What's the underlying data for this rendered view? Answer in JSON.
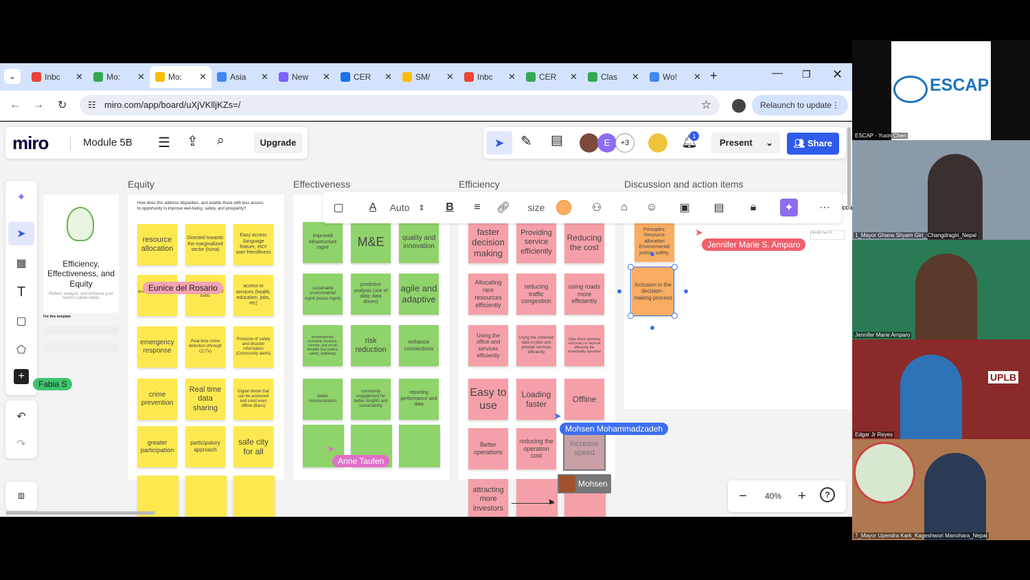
{
  "browser": {
    "tabs": [
      {
        "label": "Inbc",
        "color": "#ea4335"
      },
      {
        "label": "Mo:",
        "color": "#34a853"
      },
      {
        "label": "Mo:",
        "color": "#fbbc04"
      },
      {
        "label": "Asia",
        "color": "#4285f4"
      },
      {
        "label": "New",
        "color": "#7b61ff"
      },
      {
        "label": "CER",
        "color": "#1a73e8"
      },
      {
        "label": "SM/",
        "color": "#fbbc04"
      },
      {
        "label": "Inbc",
        "color": "#ea4335"
      },
      {
        "label": "CER",
        "color": "#34a853"
      },
      {
        "label": "Clas",
        "color": "#34a853"
      },
      {
        "label": "Wo!",
        "color": "#4285f4"
      }
    ],
    "url": "miro.com/app/board/uXjVKlljKZs=/",
    "relaunch": "Relaunch to update"
  },
  "miro": {
    "logo": "miro",
    "board_name": "Module 5B",
    "upgrade": "Upgrade",
    "present": "Present",
    "share": "Share",
    "avatar_extra": "+3",
    "avatar_e": "E",
    "notif_count": "1",
    "zoom": "40%",
    "template_title": "Efficiency, Effectiveness, and Equity",
    "template_sub": "Reflect, analyze, and enhance your team's collaboration",
    "template_hint": "For this template",
    "toolbar": {
      "font": "Auto",
      "size": "size"
    },
    "sections": [
      "Equity",
      "Effectiveness",
      "Efficiency",
      "Discussion and action items"
    ],
    "equity_prompt": "How does this address disparities, and enable those with less access to opportunity to improve well-being, safety, and prosperity?",
    "equity": [
      "resource allocation",
      "Directed towards the marginalized sector (Isma)",
      "Easy access (language feature, etcV user friendliness",
      "",
      "",
      "access to services (health, education, jobs, etc)",
      "emergency response",
      "Real-time crime detection (through CCTV)",
      "Provision of safety and disaster information (Community alerts)",
      "crime prevention",
      "Real time data sharing",
      "Digital divide that can be accessed and used even offline (Baco)",
      "greater participation",
      "participatory approach",
      "safe city for all",
      "",
      "",
      ""
    ],
    "equity_partial": [
      "environmental justice",
      "and management of traffic"
    ],
    "effectiveness": [
      "improved infrastructure mgmt",
      "M&E",
      "quality and innovation",
      "sustainable environmental mgmt (waste mgmt)",
      "predictive analysis (use of data; data driven)",
      "agile and adaptive",
      "environmental, economic (revenue, income, and social benefits (soc justice, safety, wellbeing)",
      "risk reduction",
      "enhance connections",
      "better communication",
      "community engagement for better insights and sustainability",
      "reporting performance and data",
      "",
      "",
      "",
      ""
    ],
    "efficiency": [
      "faster decision making",
      "Providing service efficiently",
      "Reducing the cost",
      "Allocating rare resources efficiently",
      "reducing traffic congestion",
      "using roads more efficiently",
      "Using the office and services efficiently",
      "Using the collected data to plan and provide services efficiently",
      "Data driven planning and policy to improve efficiently the municipality operation",
      "Easy to use",
      "Loading faster",
      "Offline",
      "Better operations",
      "reducing the operation cost",
      "increase speed",
      "attracting more investors",
      "",
      ""
    ],
    "discussion": [
      "Principles: Resource allocation Environmental justice, safety,",
      "Inclusion in the decision -making process"
    ],
    "discussion_cut": "coa",
    "cursors": [
      {
        "name": "Eunice del Rosario",
        "color": "#f4a3b4"
      },
      {
        "name": "Fabia S",
        "color": "#3ec46d"
      },
      {
        "name": "Anne Taufen",
        "color": "#e070c8"
      },
      {
        "name": "Jennifer Marie S. Amparo",
        "color": "#f0606c"
      },
      {
        "name": "Mohsen Mohammadzadeh",
        "color": "#3d6ff0"
      },
      {
        "name": "Mohsen",
        "color": "#777777"
      }
    ]
  },
  "video": {
    "escap_logo": "ESCAP",
    "tiles": [
      "ESCAP - Yuxin Chen",
      "1_Mayor Ghana Shyam Giri_ Changdragiri_Nepal",
      "Jennifer Marie Amparo",
      "Edgar Jr Reyes",
      "7_Mayor Upendra Kark_Kageshwori Manohara_Nepal"
    ],
    "uplb": "UPLB"
  },
  "colors": {
    "yellow": "#fde94f",
    "green": "#8fd36b",
    "pink": "#f5a0a8",
    "orange": "#f9ad62",
    "share": "#2f5bea",
    "ai": "#8c6df0"
  }
}
